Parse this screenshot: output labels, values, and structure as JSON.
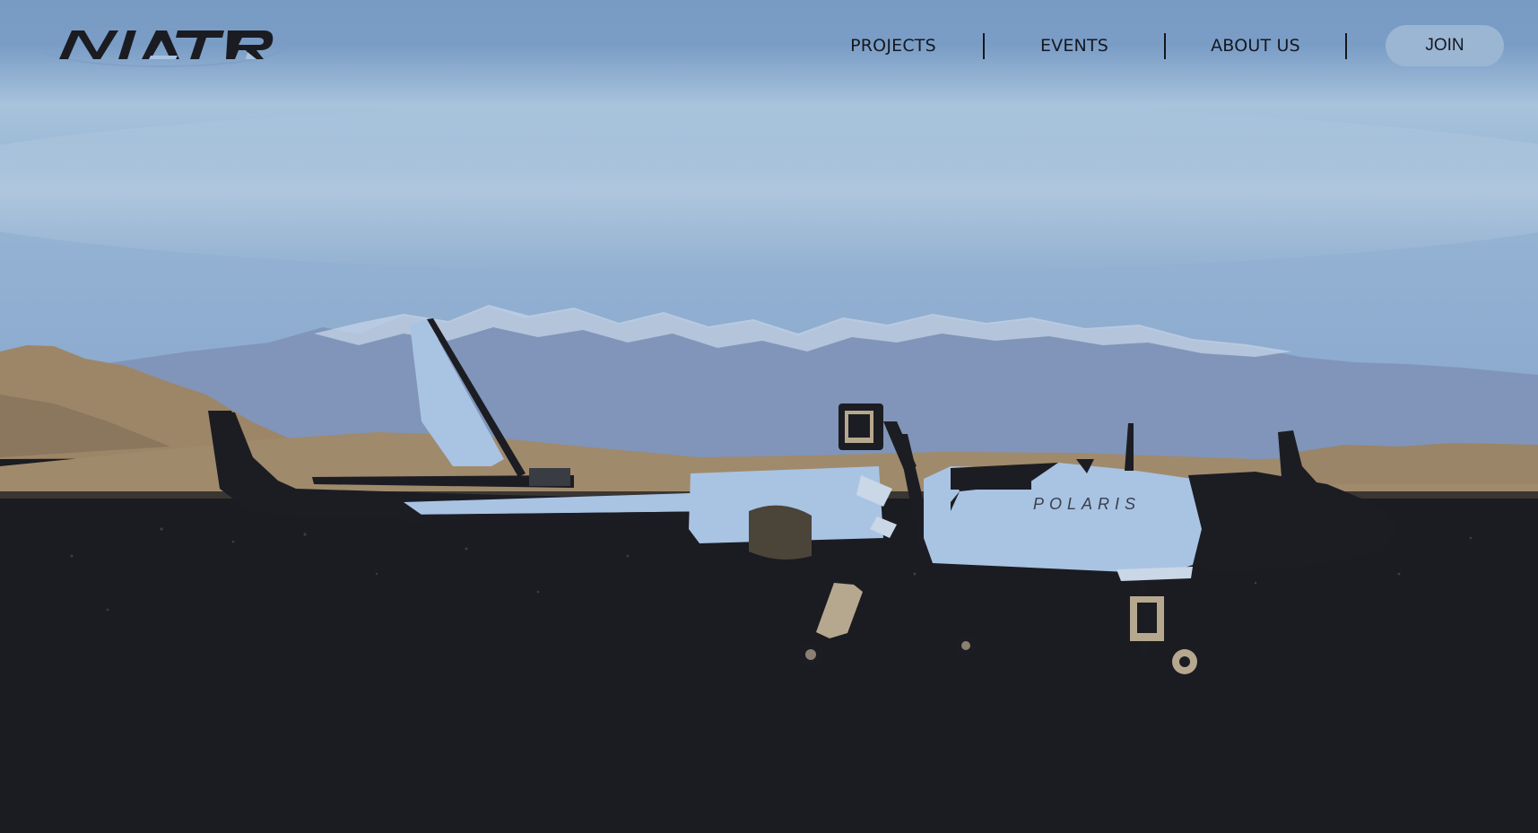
{
  "brand": {
    "logo_text": "AVIATR",
    "logo_icon": "aviatr-wordmark-logo"
  },
  "nav": {
    "items": [
      {
        "label": "PROJECTS"
      },
      {
        "label": "EVENTS"
      },
      {
        "label": "ABOUT US"
      }
    ],
    "join_label": "JOIN"
  },
  "hero": {
    "aircraft_marking": "POLARIS",
    "colors": {
      "sky_top": "#7c9ec6",
      "sky_haze": "#a9c4dd",
      "mountains": "#7e91b6",
      "hills": "#9c8668",
      "ground": "#1b1c21",
      "aircraft_body": "#a9c3e3",
      "aircraft_dark": "#1c1d23"
    }
  }
}
